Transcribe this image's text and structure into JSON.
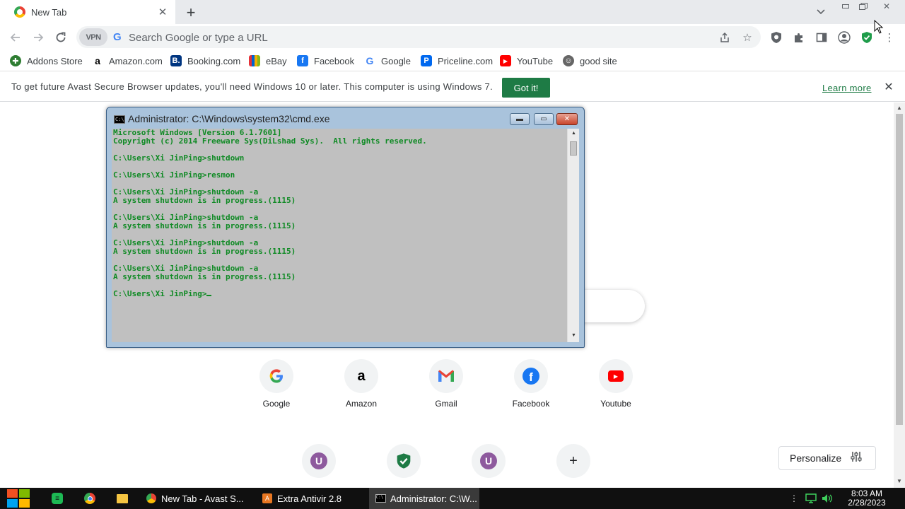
{
  "browser": {
    "tab": {
      "title": "New Tab"
    },
    "omnibox": {
      "vpn_label": "VPN",
      "placeholder": "Search Google or type a URL"
    },
    "bookmarks": [
      {
        "label": "Addons Store",
        "icon": "addons-icon",
        "color": "#2e7d32"
      },
      {
        "label": "Amazon.com",
        "icon": "amazon-icon",
        "color": "#000000"
      },
      {
        "label": "Booking.com",
        "icon": "booking-icon",
        "color": "#003580"
      },
      {
        "label": "eBay",
        "icon": "ebay-icon",
        "color": "#e53238"
      },
      {
        "label": "Facebook",
        "icon": "facebook-icon",
        "color": "#1877f2"
      },
      {
        "label": "Google",
        "icon": "google-icon",
        "color": "#4285f4"
      },
      {
        "label": "Priceline.com",
        "icon": "priceline-icon",
        "color": "#0068ef"
      },
      {
        "label": "YouTube",
        "icon": "youtube-icon",
        "color": "#ff0000"
      },
      {
        "label": "good site",
        "icon": "site-icon",
        "color": "#555555"
      }
    ],
    "infobar": {
      "message": "To get future Avast Secure Browser updates, you'll need Windows 10 or later. This computer is using Windows 7.",
      "button": "Got it!",
      "link": "Learn more"
    }
  },
  "newtab": {
    "shortcuts": [
      {
        "label": "Google",
        "icon": "google-icon"
      },
      {
        "label": "Amazon",
        "icon": "amazon-icon"
      },
      {
        "label": "Gmail",
        "icon": "gmail-icon"
      },
      {
        "label": "Facebook",
        "icon": "facebook-icon"
      },
      {
        "label": "Youtube",
        "icon": "youtube-icon"
      }
    ],
    "shortcuts_row2": [
      {
        "letter": "U",
        "icon": "user-letter-icon",
        "color": "#8e5a9e"
      },
      {
        "letter": "",
        "icon": "avast-shield-icon",
        "color": "#1e7b45"
      },
      {
        "letter": "U",
        "icon": "user-letter-icon",
        "color": "#8e5a9e"
      },
      {
        "letter": "+",
        "icon": "add-shortcut-icon",
        "color": "#202124"
      }
    ],
    "personalize": "Personalize"
  },
  "cmd": {
    "title": "Administrator: C:\\Windows\\system32\\cmd.exe",
    "lines": [
      "Microsoft Windows [Version 6.1.7601]",
      "Copyright (c) 2014 Freeware Sys(DiLshad Sys).  All rights reserved.",
      "",
      "C:\\Users\\Xi JinPing>shutdown",
      "",
      "C:\\Users\\Xi JinPing>resmon",
      "",
      "C:\\Users\\Xi JinPing>shutdown -a",
      "A system shutdown is in progress.(1115)",
      "",
      "C:\\Users\\Xi JinPing>shutdown -a",
      "A system shutdown is in progress.(1115)",
      "",
      "C:\\Users\\Xi JinPing>shutdown -a",
      "A system shutdown is in progress.(1115)",
      "",
      "C:\\Users\\Xi JinPing>shutdown -a",
      "A system shutdown is in progress.(1115)",
      ""
    ],
    "prompt": "C:\\Users\\Xi JinPing>"
  },
  "taskbar": {
    "tasks": [
      {
        "label": "New Tab - Avast S...",
        "icon": "avast-browser-icon"
      },
      {
        "label": "Extra Antivir 2.8",
        "icon": "antivirus-icon"
      },
      {
        "label": "Administrator: C:\\W...",
        "icon": "cmd-icon"
      }
    ],
    "time": "8:03 AM",
    "date": "2/28/2023"
  },
  "colors": {
    "accent_green": "#1e7b45",
    "cmd_text": "#0f8a24",
    "cmd_bg": "#c0c0c0"
  }
}
